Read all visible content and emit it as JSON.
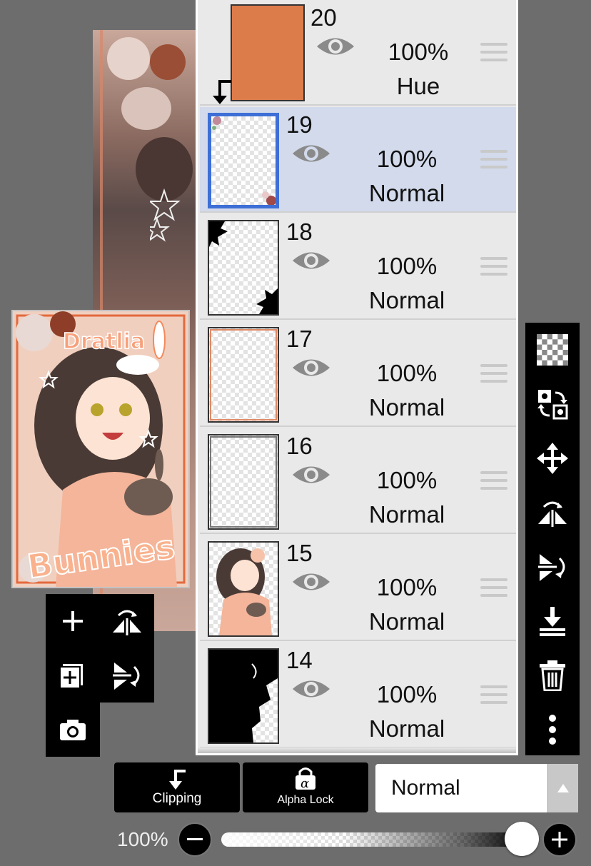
{
  "layers": [
    {
      "number": "20",
      "opacity": "100%",
      "blend": "Hue",
      "clipped": true,
      "thumb": "solid-orange"
    },
    {
      "number": "19",
      "opacity": "100%",
      "blend": "Normal",
      "selected": true,
      "thumb": "corner-flowers"
    },
    {
      "number": "18",
      "opacity": "100%",
      "blend": "Normal",
      "thumb": "black-corners"
    },
    {
      "number": "17",
      "opacity": "100%",
      "blend": "Normal",
      "thumb": "orange-frame"
    },
    {
      "number": "16",
      "opacity": "100%",
      "blend": "Normal",
      "thumb": "grey-frame"
    },
    {
      "number": "15",
      "opacity": "100%",
      "blend": "Normal",
      "thumb": "character"
    },
    {
      "number": "14",
      "opacity": "100%",
      "blend": "Normal",
      "thumb": "black-silhouette"
    }
  ],
  "colors": {
    "hue_layer": "#dc7c4a",
    "selected_row": "#d2daec",
    "selected_border": "#3d6fd6",
    "panel_bg": "#e9e9e9",
    "app_bg": "#6d6d6d"
  },
  "artwork": {
    "title_top": "Dratlia",
    "title_side": "Bunnies"
  },
  "bottom": {
    "clipping_label": "Clipping",
    "alpha_lock_label": "Alpha Lock",
    "blend_mode": "Normal",
    "opacity_label": "100%",
    "opacity_value": 1.0
  },
  "icons": {
    "canvas_tools": [
      "add-layer-icon",
      "flip-horizontal-icon",
      "duplicate-layer-icon",
      "flip-vertical-icon",
      "camera-icon"
    ],
    "right_tools": [
      "transparency-icon",
      "swap-layer-icon",
      "move-icon",
      "flip-horizontal-icon",
      "flip-vertical-icon",
      "merge-down-icon",
      "trash-icon",
      "more-icon"
    ]
  }
}
